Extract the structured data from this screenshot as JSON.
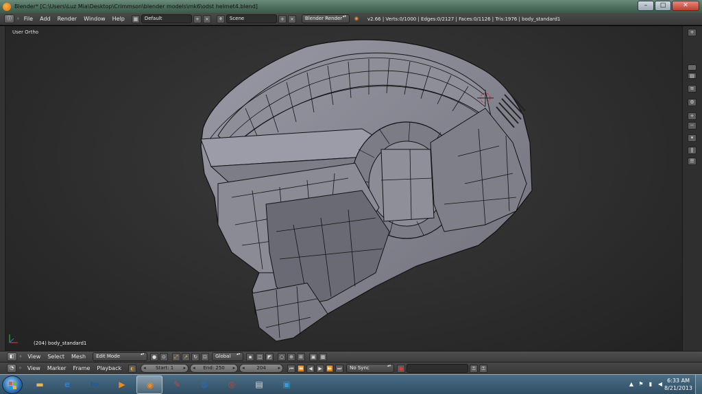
{
  "window": {
    "title": "Blender* [C:\\Users\\Luz Mia\\Desktop\\Crimmson\\blender models\\mk6\\odst helmet4.blend]",
    "min_label": "–",
    "max_label": "□",
    "close_label": "✕"
  },
  "info_header": {
    "menus": [
      "File",
      "Add",
      "Render",
      "Window",
      "Help"
    ],
    "screen_layout": "Default",
    "scene": "Scene",
    "render_engine": "Blender Render",
    "stats": "v2.66 | Verts:0/1000 | Edges:0/2127 | Faces:0/1126 | Tris:1976 | body_standard1"
  },
  "viewport": {
    "view_label": "User Ortho",
    "object_label": "(204) body_standard1"
  },
  "viewport_header": {
    "menus": [
      "View",
      "Select",
      "Mesh"
    ],
    "mode": "Edit Mode",
    "orientation": "Global"
  },
  "timeline": {
    "menus": [
      "View",
      "Marker",
      "Frame",
      "Playback"
    ],
    "start": "Start: 1",
    "end": "End: 250",
    "current": "204",
    "sync": "No Sync"
  },
  "taskbar": {
    "time": "6:33 AM",
    "date": "8/21/2013",
    "apps": [
      {
        "name": "explorer",
        "icon": "folder-icon",
        "color": "#e8b84a"
      },
      {
        "name": "internet-explorer",
        "icon": "ie-icon",
        "color": "#2a7fd4"
      },
      {
        "name": "hp",
        "icon": "hp-icon",
        "color": "#1a5aa0"
      },
      {
        "name": "media-player",
        "icon": "media-player-icon",
        "color": "#f08a1a"
      },
      {
        "name": "blender",
        "icon": "blender-icon",
        "color": "#f08a1a"
      },
      {
        "name": "paint",
        "icon": "paint-icon",
        "color": "#d04040"
      },
      {
        "name": "network",
        "icon": "globe-icon",
        "color": "#2a6ab4"
      },
      {
        "name": "chrome",
        "icon": "chrome-icon",
        "color": "#d43c2c"
      },
      {
        "name": "notepad",
        "icon": "notepad-icon",
        "color": "#ddd"
      },
      {
        "name": "virtualbox",
        "icon": "box-icon",
        "color": "#3a9ad4"
      }
    ]
  },
  "colors": {
    "viewport_bg": "#2e2e2e",
    "mesh_fill": "#8a8a95",
    "mesh_edge": "#111111",
    "header_bg": "#454545"
  }
}
